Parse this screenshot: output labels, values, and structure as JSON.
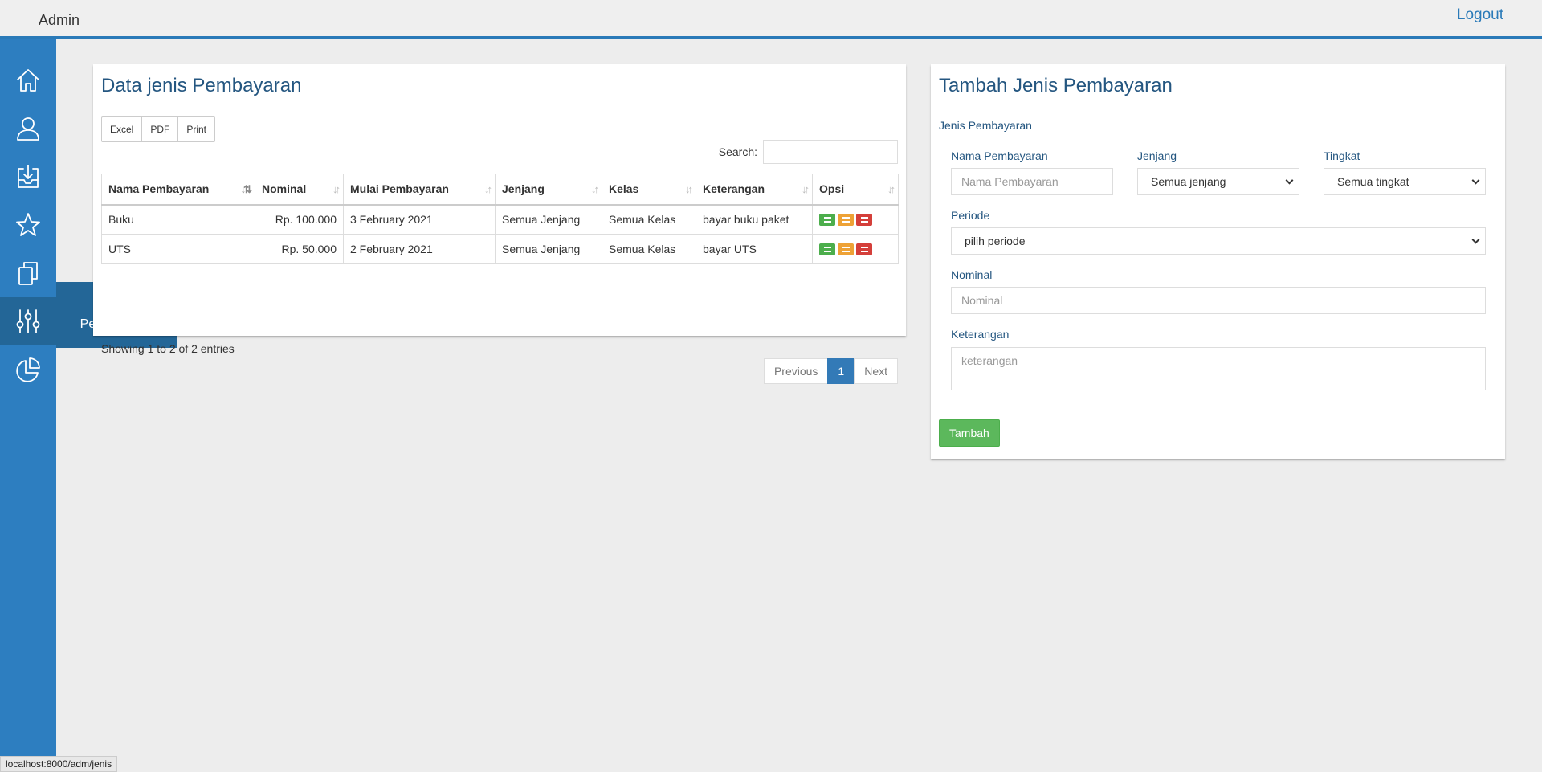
{
  "header": {
    "brand": "Admin",
    "logout": "Logout"
  },
  "sidebar": {
    "items": [
      {
        "icon": "home-icon"
      },
      {
        "icon": "user-icon"
      },
      {
        "icon": "inbox-download-icon"
      },
      {
        "icon": "star-icon"
      },
      {
        "icon": "copy-icon"
      },
      {
        "icon": "sliders-icon",
        "active": true
      },
      {
        "icon": "pie-chart-icon"
      }
    ],
    "tooltip": "Jenis Pembayaran"
  },
  "list_panel": {
    "title": "Data jenis Pembayaran",
    "export_buttons": [
      "Excel",
      "PDF",
      "Print"
    ],
    "search_label": "Search:",
    "columns": [
      "Nama Pembayaran",
      "Nominal",
      "Mulai Pembayaran",
      "Jenjang",
      "Kelas",
      "Keterangan",
      "Opsi"
    ],
    "rows": [
      {
        "nama": "Buku",
        "nominal": "Rp. 100.000",
        "mulai": "3 February 2021",
        "jenjang": "Semua Jenjang",
        "kelas": "Semua Kelas",
        "keterangan": "bayar buku paket"
      },
      {
        "nama": "UTS",
        "nominal": "Rp. 50.000",
        "mulai": "2 February 2021",
        "jenjang": "Semua Jenjang",
        "kelas": "Semua Kelas",
        "keterangan": "bayar UTS"
      }
    ],
    "info": "Showing 1 to 2 of 2 entries",
    "pagination": {
      "previous": "Previous",
      "current": "1",
      "next": "Next"
    }
  },
  "form_panel": {
    "title": "Tambah Jenis Pembayaran",
    "subtitle": "Jenis Pembayaran",
    "nama_label": "Nama Pembayaran",
    "nama_placeholder": "Nama Pembayaran",
    "jenjang_label": "Jenjang",
    "jenjang_value": "Semua jenjang",
    "tingkat_label": "Tingkat",
    "tingkat_value": "Semua tingkat",
    "periode_label": "Periode",
    "periode_value": "pilih periode",
    "nominal_label": "Nominal",
    "nominal_placeholder": "Nominal",
    "keterangan_label": "Keterangan",
    "keterangan_placeholder": "keterangan",
    "submit": "Tambah"
  },
  "status_bar": "localhost:8000/adm/jenis",
  "colors": {
    "primary": "#2d7ec0",
    "active": "#236697",
    "success": "#5cb85c",
    "warning": "#eea236",
    "danger": "#d43f3a"
  }
}
